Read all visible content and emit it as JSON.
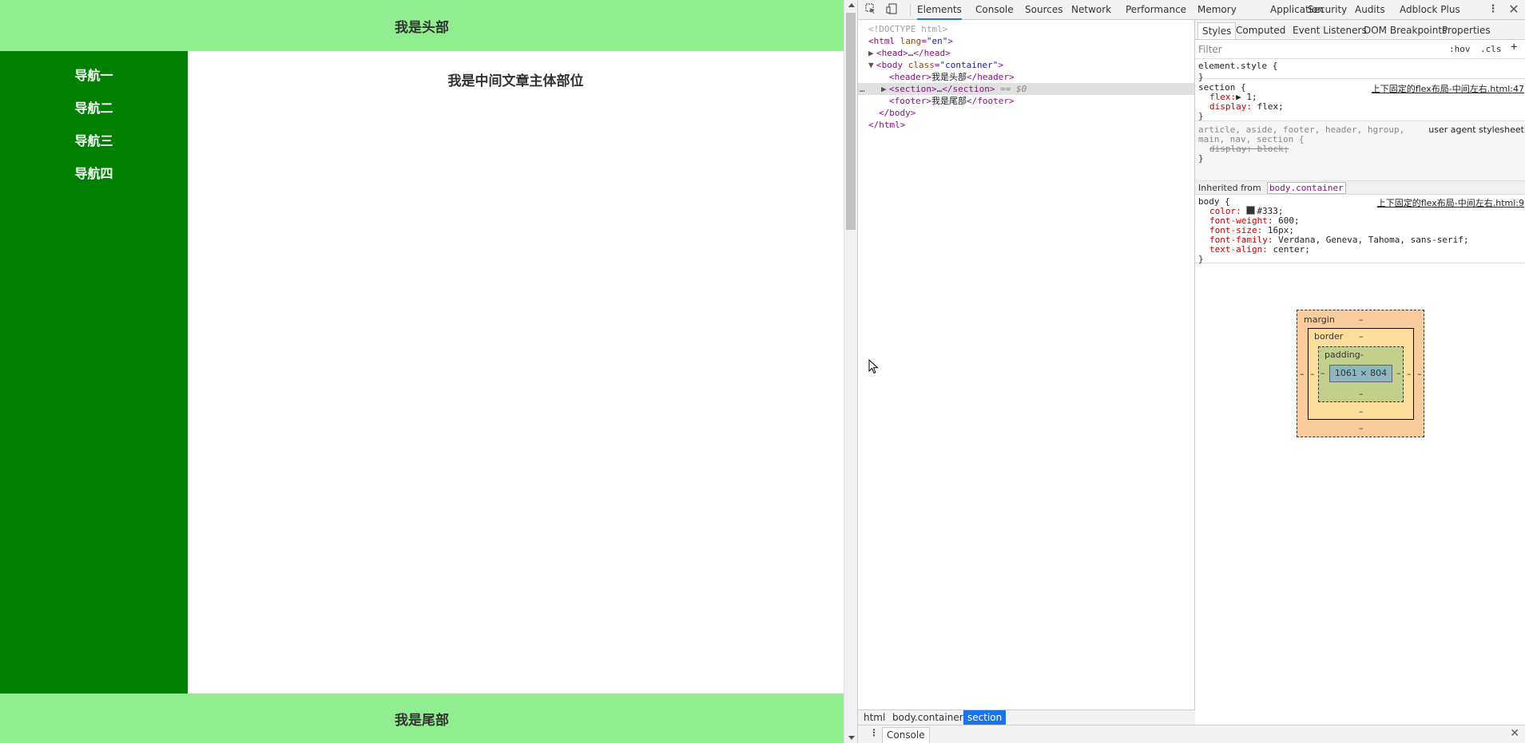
{
  "page": {
    "header": "我是头部",
    "nav": [
      "导航一",
      "导航二",
      "导航三",
      "导航四"
    ],
    "main": "我是中间文章主体部位",
    "footer": "我是尾部"
  },
  "devtools": {
    "tabs": [
      "Elements",
      "Console",
      "Sources",
      "Network",
      "Performance",
      "Memory",
      "Application",
      "Security",
      "Audits",
      "Adblock Plus"
    ],
    "active_tab": "Elements",
    "dom": {
      "doctype": "<!DOCTYPE html>",
      "html_open_tag": "<html",
      "html_lang_attr": "lang",
      "html_lang_val": "\"en\"",
      "html_open_close": ">",
      "head": "<head>",
      "head_ellipsis": "…",
      "head_close": "</head>",
      "body_open": "<body",
      "body_class_attr": "class",
      "body_class_val": "\"container\"",
      "body_open_close": ">",
      "header_open": "<header>",
      "header_text": "我是头部",
      "header_close": "</header>",
      "section_open": "<section>",
      "section_ellipsis": "…",
      "section_close": "</section>",
      "section_marker": "== $0",
      "footer_open": "<footer>",
      "footer_text": "我是尾部",
      "footer_close": "</footer>",
      "body_close": "</body>",
      "html_close": "</html>",
      "dots": "…"
    },
    "breadcrumbs": [
      "html",
      "body.container",
      "section"
    ],
    "styles_subtabs": [
      "Styles",
      "Computed",
      "Event Listeners",
      "DOM Breakpoints",
      "Properties"
    ],
    "filter_placeholder": "Filter",
    "hov": ":hov",
    "cls": ".cls",
    "plus": "+",
    "rules": {
      "element_style": "element.style {",
      "close": "}",
      "section_sel": "section {",
      "section_src": "上下固定的flex布局-中间左右.html:47",
      "flex_prop": "flex:",
      "flex_val": "▶ 1;",
      "display_prop": "display:",
      "display_val": "flex;",
      "ua_sel_1": "article, aside, footer, header, hgroup,",
      "ua_src": "user agent stylesheet",
      "ua_sel_2": "main, nav, section {",
      "ua_strike": "display: block;",
      "inherited_label": "Inherited from",
      "inherited_target": "body.container",
      "body_sel": "body {",
      "body_src": "上下固定的flex布局-中间左右.html:9",
      "color_prop": "color:",
      "color_val": "#333;",
      "fw_prop": "font-weight:",
      "fw_val": "600;",
      "fs_prop": "font-size:",
      "fs_val": "16px;",
      "ff_prop": "font-family:",
      "ff_val": "Verdana, Geneva, Tahoma, sans-serif;",
      "ta_prop": "text-align:",
      "ta_val": "center;"
    },
    "box_model": {
      "margin": "margin",
      "border": "border",
      "padding": "padding-",
      "dash": "–",
      "content": "1061 × 804"
    },
    "drawer_tab": "Console"
  },
  "colors": {
    "header_bg": "#90ee90",
    "nav_bg": "#008000",
    "text": "#333333",
    "accent": "#1a73e8"
  }
}
